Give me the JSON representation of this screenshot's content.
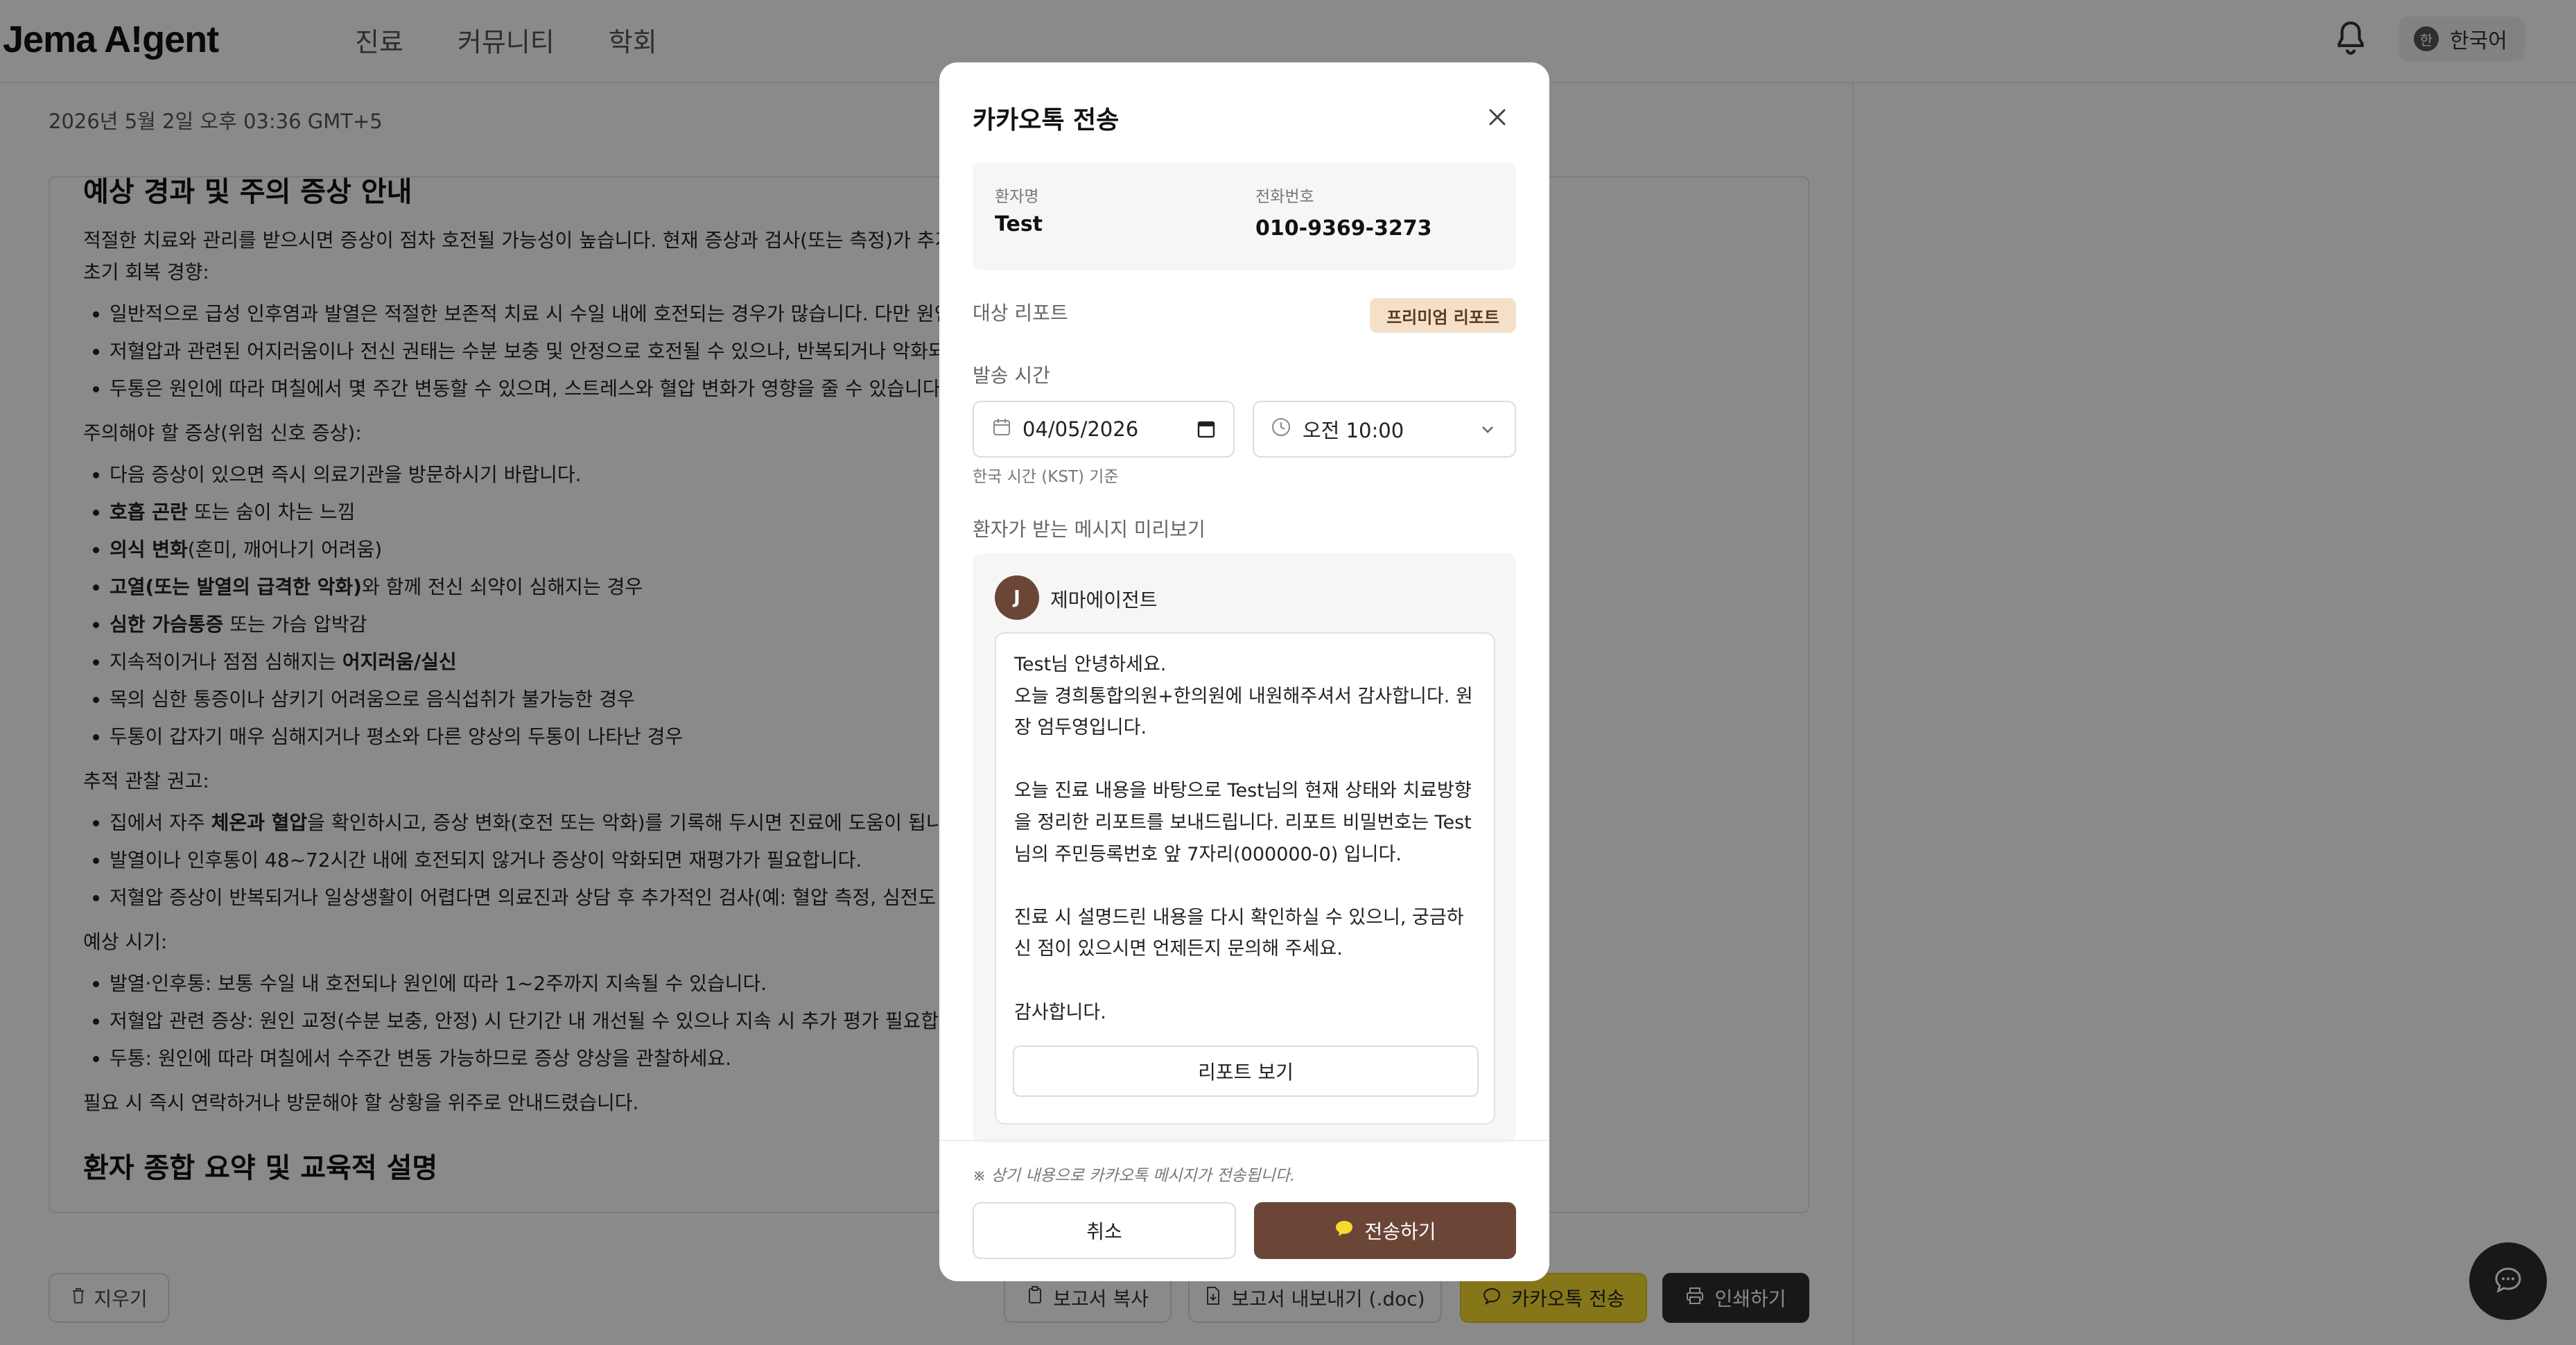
{
  "app": {
    "logo": "Jema A!gent"
  },
  "nav": [
    {
      "label": "진료"
    },
    {
      "label": "커뮤니티"
    },
    {
      "label": "학회"
    }
  ],
  "header": {
    "lang_badge": "한",
    "lang_label": "한국어"
  },
  "main": {
    "timestamp": "2026년 5월 2일 오후 03:36 GMT+5",
    "heading1": "예상 경과 및 주의 증상 안내",
    "intro": "적절한 치료와 관리를 받으시면 증상이 점차 호전될 가능성이 높습니다. 현재 증상과 검사(또는 측정)가 추가로 이루",
    "recovery_label": "초기 회복 경향:",
    "recovery_items": [
      "일반적으로 급성 인후염과 발열은 적절한 보존적 치료 시 수일 내에 호전되는 경우가 많습니다. 다만 원인(바이러",
      "저혈압과 관련된 어지러움이나 전신 권태는 수분 보충 및 안정으로 호전될 수 있으나, 반복되거나 악화되면 추가",
      "두통은 원인에 따라 며칠에서 몇 주간 변동할 수 있으며, 스트레스와 혈압 변화가 영향을 줄 수 있습니다."
    ],
    "warning_label": "주의해야 할 증상(위험 신호 증상):",
    "warning_items": [
      {
        "bold": "",
        "text": "다음 증상이 있으면 즉시 의료기관을 방문하시기 바랍니다.",
        "bold_after": ""
      },
      {
        "bold": "호흡 곤란",
        "text": " 또는 숨이 차는 느낌",
        "bold_after": ""
      },
      {
        "bold": "의식 변화",
        "text": "(혼미, 깨어나기 어려움)",
        "bold_after": ""
      },
      {
        "bold": "고열(또는 발열의 급격한 악화)",
        "text": "와 함께 전신 쇠약이 심해지는 경우",
        "bold_after": ""
      },
      {
        "bold": "심한 가슴통증",
        "text": " 또는 가슴 압박감",
        "bold_after": ""
      },
      {
        "bold": "",
        "text": "지속적이거나 점점 심해지는 ",
        "bold_after": "어지러움/실신"
      },
      {
        "bold": "",
        "text": "목의 심한 통증이나 삼키기 어려움으로 음식섭취가 불가능한 경우",
        "bold_after": ""
      },
      {
        "bold": "",
        "text": "두통이 갑자기 매우 심해지거나 평소와 다른 양상의 두통이 나타난 경우",
        "bold_after": ""
      }
    ],
    "followup_label": "추적 관찰 권고:",
    "followup_items": [
      {
        "pre": "집에서 자주 ",
        "bold": "체온과 혈압",
        "post": "을 확인하시고, 증상 변화(호전 또는 악화)를 기록해 두시면 진료에 도움이 됩니다."
      },
      {
        "pre": "발열이나 인후통이 48~72시간 내에 호전되지 않거나 증상이 악화되면 재평가가 필요합니다.",
        "bold": "",
        "post": ""
      },
      {
        "pre": "저혈압 증상이 반복되거나 일상생활이 어렵다면 의료진과 상담 후 추가적인 검사(예: 혈압 측정, 심전도 등)를 권",
        "bold": "",
        "post": ""
      }
    ],
    "timing_label": "예상 시기:",
    "timing_items": [
      "발열·인후통: 보통 수일 내 호전되나 원인에 따라 1~2주까지 지속될 수 있습니다.",
      "저혈압 관련 증상: 원인 교정(수분 보충, 안정) 시 단기간 내 개선될 수 있으나 지속 시 추가 평가 필요합니다.",
      "두통: 원인에 따라 며칠에서 수주간 변동 가능하므로 증상 양상을 관찰하세요."
    ],
    "closing": "필요 시 즉시 연락하거나 방문해야 할 상황을 위주로 안내드렸습니다.",
    "heading2": "환자 종합 요약 및 교육적 설명"
  },
  "bottombar": {
    "clear": "지우기",
    "copy": "보고서 복사",
    "export": "보고서 내보내기 (.doc)",
    "kakao": "카카오톡 전송",
    "print": "인쇄하기"
  },
  "modal": {
    "title": "카카오톡 전송",
    "patient_label": "환자명",
    "patient_name": "Test",
    "phone_label": "전화번호",
    "phone": "010-9369-3273",
    "target_label": "대상 리포트",
    "target_badge": "프리미엄 리포트",
    "send_time_label": "발송 시간",
    "date_value": "04/05/2026",
    "time_value": "오전 10:00",
    "timezone_note": "한국 시간 (KST) 기준",
    "preview_label": "환자가 받는 메시지 미리보기",
    "sender_initial": "J",
    "sender_name": "제마에이전트",
    "message": "Test님 안녕하세요.\n오늘 경희통합의원+한의원에 내원해주셔서 감사합니다. 원장 엄두영입니다.\n\n오늘 진료 내용을 바탕으로 Test님의 현재 상태와 치료방향을 정리한 리포트를 보내드립니다. 리포트 비밀번호는 Test님의 주민등록번호 앞 7자리(000000-0) 입니다.\n\n진료 시 설명드린 내용을 다시 확인하실 수 있으니, 궁금하신 점이 있으시면 언제든지 문의해 주세요.\n\n감사합니다.",
    "report_button": "리포트 보기",
    "footer_note": "※ 상기 내용으로 카카오톡 메시지가 전송됩니다.",
    "cancel": "취소",
    "send": "전송하기"
  },
  "colors": {
    "brand_brown": "#6b4636",
    "kakao_yellow": "#f6dc2f",
    "premium_badge_bg": "#f4e0c9",
    "overlay": "rgba(0,0,0,0.46)"
  },
  "icons": {
    "bell": "bell-icon",
    "close": "close-icon",
    "calendar": "calendar-icon",
    "clock": "clock-icon",
    "chevron": "chevron-down-icon",
    "chat": "chat-icon",
    "trash": "trash-icon",
    "copy": "copy-icon",
    "export": "document-export-icon",
    "kakao": "kakao-chat-icon",
    "print": "printer-icon"
  }
}
